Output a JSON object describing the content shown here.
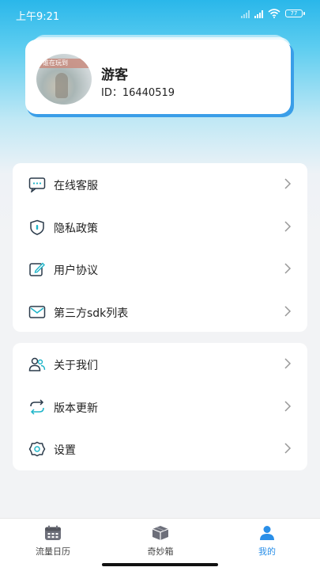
{
  "status_bar": {
    "time": "上午9:21",
    "battery": "77"
  },
  "profile": {
    "username": "游客",
    "user_id": "ID：16440519",
    "avatar_banner_text": "谁在玩到"
  },
  "menu_group_1": [
    {
      "label": "在线客服",
      "icon": "chat-icon"
    },
    {
      "label": "隐私政策",
      "icon": "shield-icon"
    },
    {
      "label": "用户协议",
      "icon": "edit-icon"
    },
    {
      "label": "第三方sdk列表",
      "icon": "mail-icon"
    }
  ],
  "menu_group_2": [
    {
      "label": "关于我们",
      "icon": "users-icon"
    },
    {
      "label": "版本更新",
      "icon": "refresh-icon"
    },
    {
      "label": "设置",
      "icon": "settings-icon"
    }
  ],
  "bottom_nav": {
    "tabs": [
      {
        "label": "流量日历",
        "icon": "calendar-icon",
        "active": false
      },
      {
        "label": "奇妙箱",
        "icon": "box-icon",
        "active": false
      },
      {
        "label": "我的",
        "icon": "person-icon",
        "active": true
      }
    ]
  },
  "colors": {
    "accent": "#2a8fe8",
    "header_top": "#2ab7ea",
    "page_bg": "#f2f3f5"
  }
}
